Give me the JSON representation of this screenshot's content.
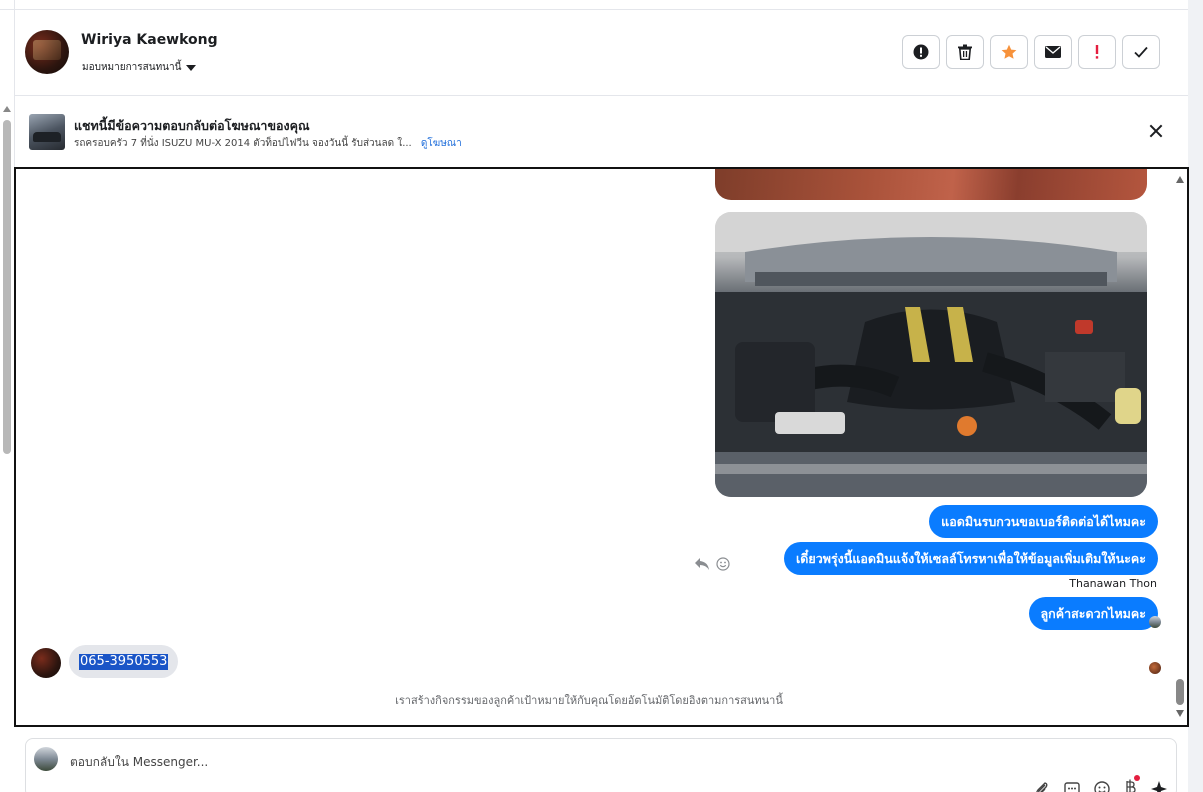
{
  "header": {
    "contact_name": "Wiriya Kaewkong",
    "assign_label": "มอบหมายการสนทนานี้",
    "actions": [
      {
        "name": "spam-icon",
        "color": "#1c1e21"
      },
      {
        "name": "trash-icon",
        "color": "#1c1e21"
      },
      {
        "name": "star-icon",
        "color": "#f7923b"
      },
      {
        "name": "mail-icon",
        "color": "#1c1e21"
      },
      {
        "name": "exclamation-icon",
        "color": "#e41e3f"
      },
      {
        "name": "check-icon",
        "color": "#1c1e21"
      }
    ]
  },
  "ad_bar": {
    "title": "แชทนี้มีข้อความตอบกลับต่อโฆษณาของคุณ",
    "subtitle": "รถครอบครัว 7 ที่นั่ง ISUZU MU-X 2014 ตัวท็อปไฟวีน จองวันนี้ รับส่วนลด ใ...",
    "link_label": "ดูโฆษณา"
  },
  "messages": {
    "outgoing": [
      "แอดมินรบกวนขอเบอร์ติดต่อได้ไหมคะ",
      "เดี๋ยวพรุ่งนี้แอดมินแจ้งให้เซลล์โทรหาเพื่อให้ข้อมูลเพิ่มเติมให้นะคะ",
      "ลูกค้าสะดวกไหมคะ"
    ],
    "sender_label": "Thanawan Thon",
    "incoming": "065-3950553",
    "footer_note": "เราสร้างกิจกรรมของลูกค้าเป้าหมายให้กับคุณโดยอัตโนมัติโดยอิงตามการสนทนานี้"
  },
  "composer": {
    "placeholder": "ตอบกลับใน Messenger..."
  },
  "colors": {
    "accent": "#0a7cff",
    "link": "#216fdb",
    "star": "#f7923b",
    "alert": "#e41e3f"
  }
}
